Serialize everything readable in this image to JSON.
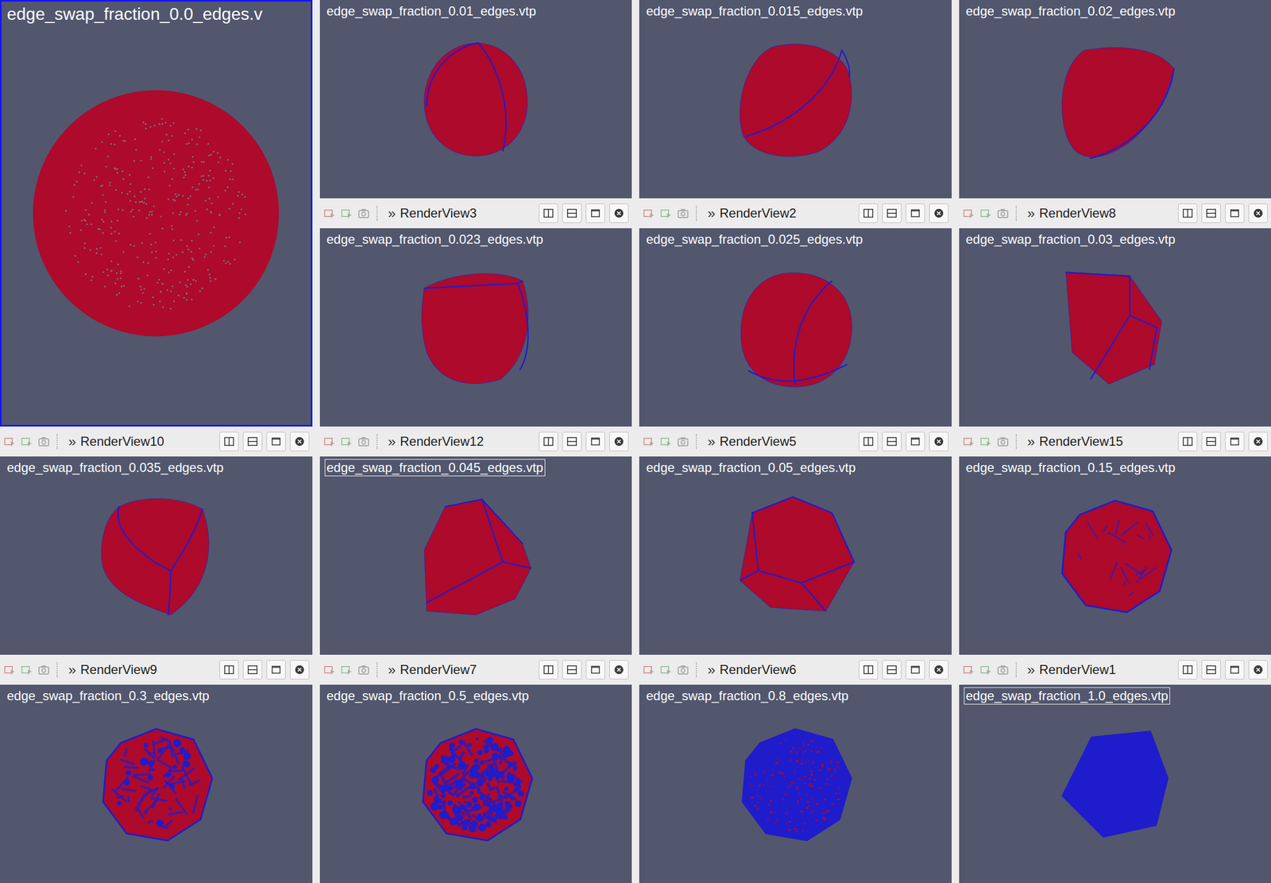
{
  "views": [
    {
      "title": "edge_swap_fraction_0.0_edges.v",
      "selected": true,
      "title_boxed": false
    },
    {
      "title": "edge_swap_fraction_0.01_edges.vtp",
      "selected": false,
      "title_boxed": false
    },
    {
      "title": "edge_swap_fraction_0.015_edges.vtp",
      "selected": false,
      "title_boxed": false
    },
    {
      "title": "edge_swap_fraction_0.02_edges.vtp",
      "selected": false,
      "title_boxed": false
    },
    {
      "title": "edge_swap_fraction_0.023_edges.vtp",
      "selected": false,
      "title_boxed": false,
      "toolbar": {
        "chevron": "»",
        "label": "RenderView3"
      }
    },
    {
      "title": "edge_swap_fraction_0.025_edges.vtp",
      "selected": false,
      "title_boxed": false,
      "toolbar": {
        "chevron": "»",
        "label": "RenderView2"
      }
    },
    {
      "title": "edge_swap_fraction_0.03_edges.vtp",
      "selected": false,
      "title_boxed": false,
      "toolbar": {
        "chevron": "»",
        "label": "RenderView8"
      }
    },
    {
      "title": "edge_swap_fraction_0.035_edges.vtp",
      "selected": false,
      "title_boxed": false,
      "toolbar": {
        "chevron": "»",
        "label": "RenderView10"
      }
    },
    {
      "title": "edge_swap_fraction_0.045_edges.vtp",
      "selected": false,
      "title_boxed": true,
      "toolbar": {
        "chevron": "»",
        "label": "RenderView12"
      }
    },
    {
      "title": "edge_swap_fraction_0.05_edges.vtp",
      "selected": false,
      "title_boxed": false,
      "toolbar": {
        "chevron": "»",
        "label": "RenderView5"
      }
    },
    {
      "title": "edge_swap_fraction_0.15_edges.vtp",
      "selected": false,
      "title_boxed": false,
      "toolbar": {
        "chevron": "»",
        "label": "RenderView15"
      }
    },
    {
      "title": "edge_swap_fraction_0.3_edges.vtp",
      "selected": false,
      "title_boxed": false,
      "toolbar": {
        "chevron": "»",
        "label": "RenderView9"
      }
    },
    {
      "title": "edge_swap_fraction_0.5_edges.vtp",
      "selected": false,
      "title_boxed": false,
      "toolbar": {
        "chevron": "»",
        "label": "RenderView7"
      }
    },
    {
      "title": "edge_swap_fraction_0.8_edges.vtp",
      "selected": false,
      "title_boxed": false,
      "toolbar": {
        "chevron": "»",
        "label": "RenderView6"
      }
    },
    {
      "title": "edge_swap_fraction_1.0_edges.vtp",
      "selected": false,
      "title_boxed": true,
      "toolbar": {
        "chevron": "»",
        "label": "RenderView1"
      }
    }
  ]
}
